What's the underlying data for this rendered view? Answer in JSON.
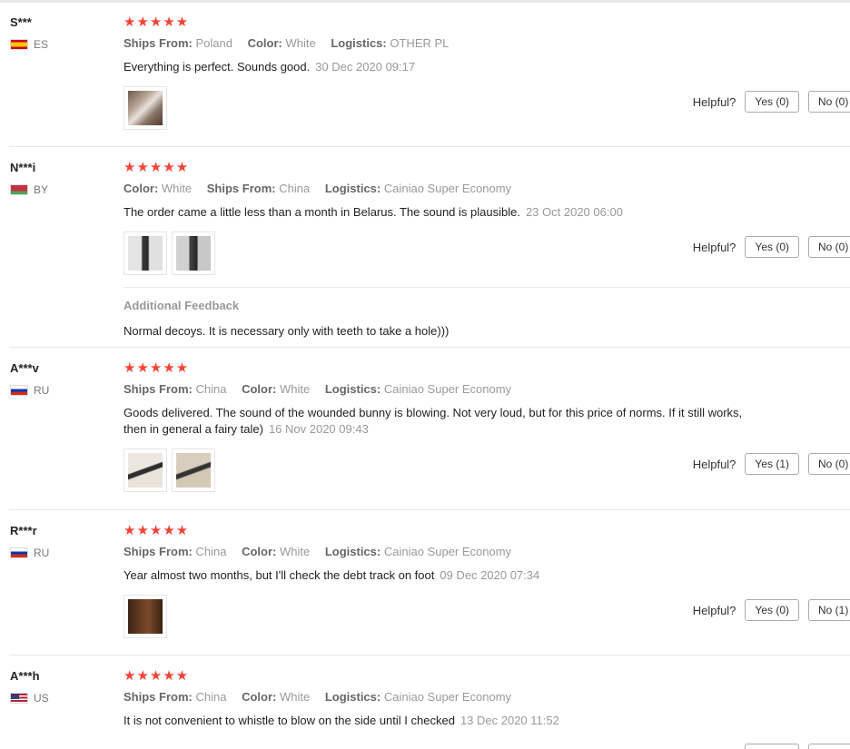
{
  "helpful_label": "Helpful?",
  "reviews": [
    {
      "user": "S***",
      "country": "ES",
      "stars": "★★★★★",
      "meta": [
        {
          "label": "Ships From:",
          "value": "Poland"
        },
        {
          "label": "Color:",
          "value": "White"
        },
        {
          "label": "Logistics:",
          "value": "OTHER PL"
        }
      ],
      "text": "Everything is perfect. Sounds good.",
      "date": "30 Dec 2020 09:17",
      "yes": "Yes (0)",
      "no": "No (0)"
    },
    {
      "user": "N***i",
      "country": "BY",
      "stars": "★★★★★",
      "meta": [
        {
          "label": "Color:",
          "value": "White"
        },
        {
          "label": "Ships From:",
          "value": "China"
        },
        {
          "label": "Logistics:",
          "value": "Cainiao Super Economy"
        }
      ],
      "text": "The order came a little less than a month in Belarus. The sound is plausible.",
      "date": "23 Oct 2020 06:00",
      "yes": "Yes (0)",
      "no": "No (0)",
      "additional_title": "Additional Feedback",
      "additional_text": "Normal decoys. It is necessary only with teeth to take a hole)))"
    },
    {
      "user": "A***v",
      "country": "RU",
      "stars": "★★★★★",
      "meta": [
        {
          "label": "Ships From:",
          "value": "China"
        },
        {
          "label": "Color:",
          "value": "White"
        },
        {
          "label": "Logistics:",
          "value": "Cainiao Super Economy"
        }
      ],
      "text": "Goods delivered. The sound of the wounded bunny is blowing. Not very loud, but for this price of norms. If it still works, then in general a fairy tale)",
      "date": "16 Nov 2020 09:43",
      "yes": "Yes (1)",
      "no": "No (0)"
    },
    {
      "user": "R***r",
      "country": "RU",
      "stars": "★★★★★",
      "meta": [
        {
          "label": "Ships From:",
          "value": "China"
        },
        {
          "label": "Color:",
          "value": "White"
        },
        {
          "label": "Logistics:",
          "value": "Cainiao Super Economy"
        }
      ],
      "text": "Year almost two months, but I'll check the debt track on foot",
      "date": "09 Dec 2020 07:34",
      "yes": "Yes (0)",
      "no": "No (1)"
    },
    {
      "user": "A***h",
      "country": "US",
      "stars": "★★★★★",
      "meta": [
        {
          "label": "Ships From:",
          "value": "China"
        },
        {
          "label": "Color:",
          "value": "White"
        },
        {
          "label": "Logistics:",
          "value": "Cainiao Super Economy"
        }
      ],
      "text": "It is not convenient to whistle to blow on the side until I checked",
      "date": "13 Dec 2020 11:52"
    }
  ]
}
